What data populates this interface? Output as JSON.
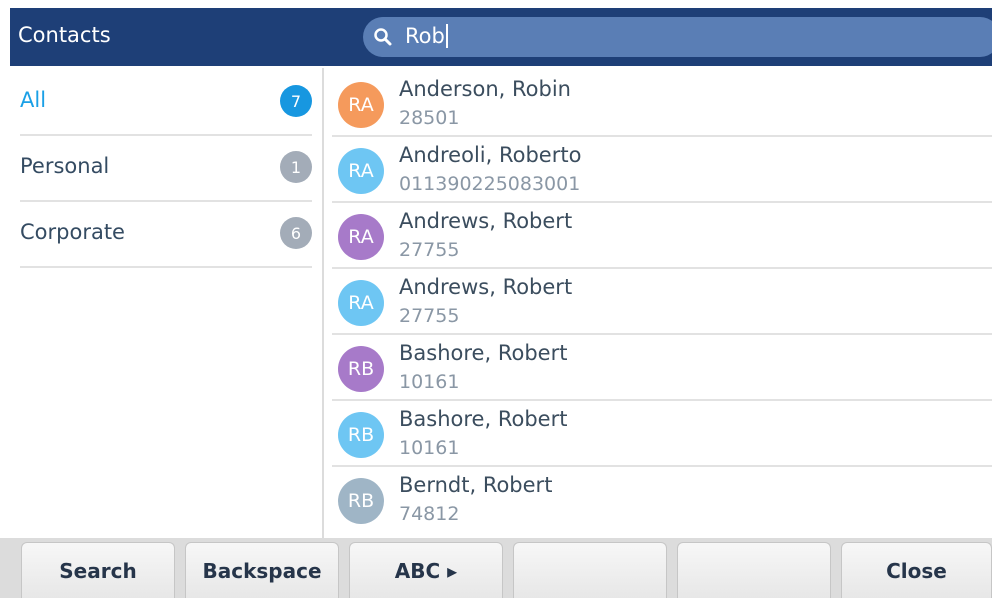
{
  "header": {
    "title": "Contacts",
    "search_value": "Rob"
  },
  "categories": [
    {
      "label": "All",
      "count": "7",
      "active": true
    },
    {
      "label": "Personal",
      "count": "1",
      "active": false
    },
    {
      "label": "Corporate",
      "count": "6",
      "active": false
    }
  ],
  "contacts": [
    {
      "initials": "RA",
      "name": "Anderson, Robin",
      "number": "28501",
      "color": "#f59a5c"
    },
    {
      "initials": "RA",
      "name": "Andreoli, Roberto",
      "number": "011390225083001",
      "color": "#6ec6f3"
    },
    {
      "initials": "RA",
      "name": "Andrews, Robert",
      "number": "27755",
      "color": "#a77ac9"
    },
    {
      "initials": "RA",
      "name": "Andrews, Robert",
      "number": "27755",
      "color": "#6ec6f3"
    },
    {
      "initials": "RB",
      "name": "Bashore, Robert",
      "number": "10161",
      "color": "#a77ac9"
    },
    {
      "initials": "RB",
      "name": "Bashore, Robert",
      "number": "10161",
      "color": "#6ec6f3"
    },
    {
      "initials": "RB",
      "name": "Berndt, Robert",
      "number": "74812",
      "color": "#9fb5c6"
    }
  ],
  "softkeys": [
    "Search",
    "Backspace",
    "ABC ▸",
    "",
    "",
    "Close"
  ],
  "colors": {
    "header_bg": "#1e3f77",
    "search_bg": "#5a7eb5",
    "active_accent": "#1797e0"
  }
}
